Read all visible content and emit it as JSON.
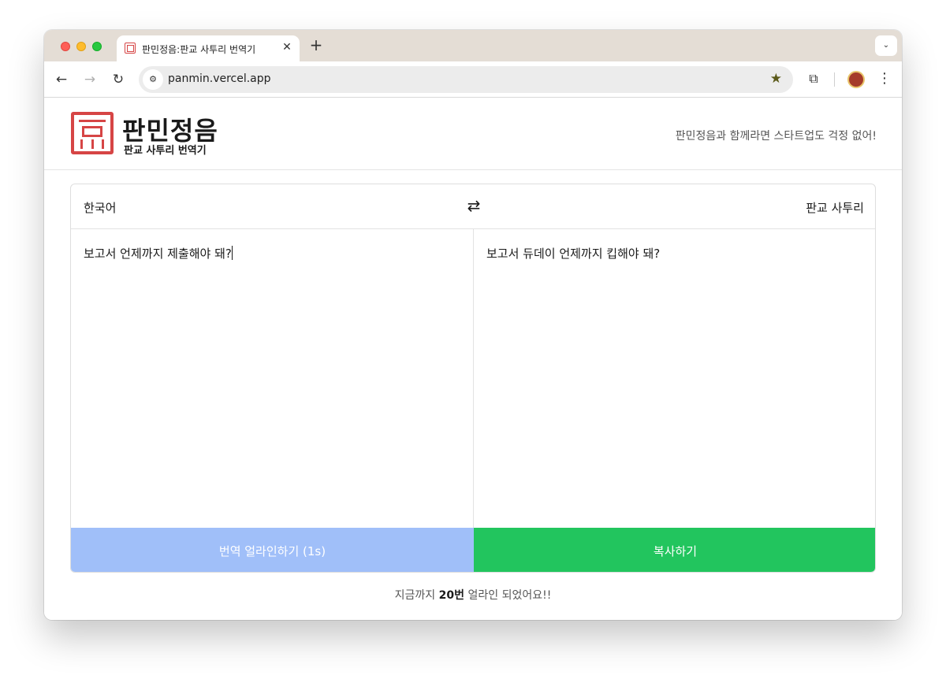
{
  "browser": {
    "tab_title": "판민정음:판교 사투리 번역기",
    "tab_close": "✕",
    "new_tab": "+",
    "tab_menu": "⌄",
    "url": "panmin.vercel.app",
    "nav_back": "←",
    "nav_forward": "→",
    "nav_reload": "↻",
    "site_info_icon": "⚙",
    "bookmark_icon": "★",
    "extensions_icon": "⧉",
    "menu_icon": "⋮"
  },
  "header": {
    "logo_title": "판민정음",
    "logo_subtitle": "판교 사투리 번역기",
    "tagline": "판민정음과 함께라면 스타트업도 걱정 없어!"
  },
  "translator": {
    "source_lang": "한국어",
    "swap_icon": "⇄",
    "target_lang": "판교 사투리",
    "source_text": "보고서 언제까지 제출해야 돼?",
    "target_text": "보고서 듀데이 언제까지 킵해야 돼?",
    "translate_button": "번역 얼라인하기 (1s)",
    "copy_button": "복사하기"
  },
  "footer": {
    "prefix": "지금까지 ",
    "count": "20번",
    "suffix": " 얼라인 되었어요!!"
  },
  "colors": {
    "brand_red": "#d64545",
    "translate_button_bg": "#a0bff9",
    "copy_button_bg": "#22c55e"
  }
}
